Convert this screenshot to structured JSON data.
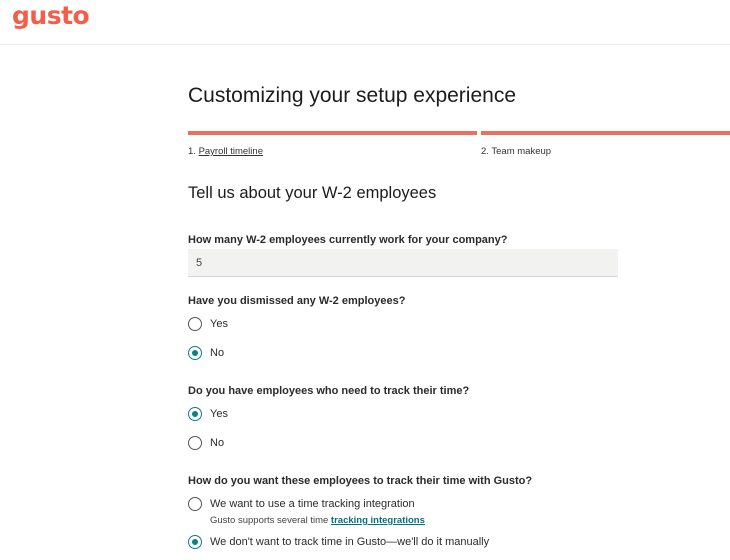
{
  "brand": {
    "logo_text": "gusto",
    "accent_color": "#f45d48",
    "progress_color": "#e7735e",
    "selected_color": "#0a8080"
  },
  "header": {
    "title": "Customizing your setup experience"
  },
  "steps": [
    {
      "label": "1. ",
      "link": "Payroll timeline"
    },
    {
      "label": "2. Team makeup"
    }
  ],
  "section": {
    "title": "Tell us about your W-2 employees"
  },
  "questions": {
    "employee_count": {
      "label": "How many W-2 employees currently work for your company?",
      "value": "5"
    },
    "dismissed": {
      "label": "Have you dismissed any W-2 employees?",
      "options": [
        "Yes",
        "No"
      ],
      "selected": "No"
    },
    "track_time": {
      "label": "Do you have employees who need to track their time?",
      "options": [
        "Yes",
        "No"
      ],
      "selected": "Yes"
    },
    "track_method": {
      "label": "How do you want these employees to track their time with Gusto?",
      "options": [
        "We want to use a time tracking integration",
        "We don't want to track time in Gusto—we'll do it manually"
      ],
      "helper_prefix": "Gusto supports several time ",
      "helper_link": "tracking integrations",
      "selected": "We don't want to track time in Gusto—we'll do it manually"
    }
  }
}
